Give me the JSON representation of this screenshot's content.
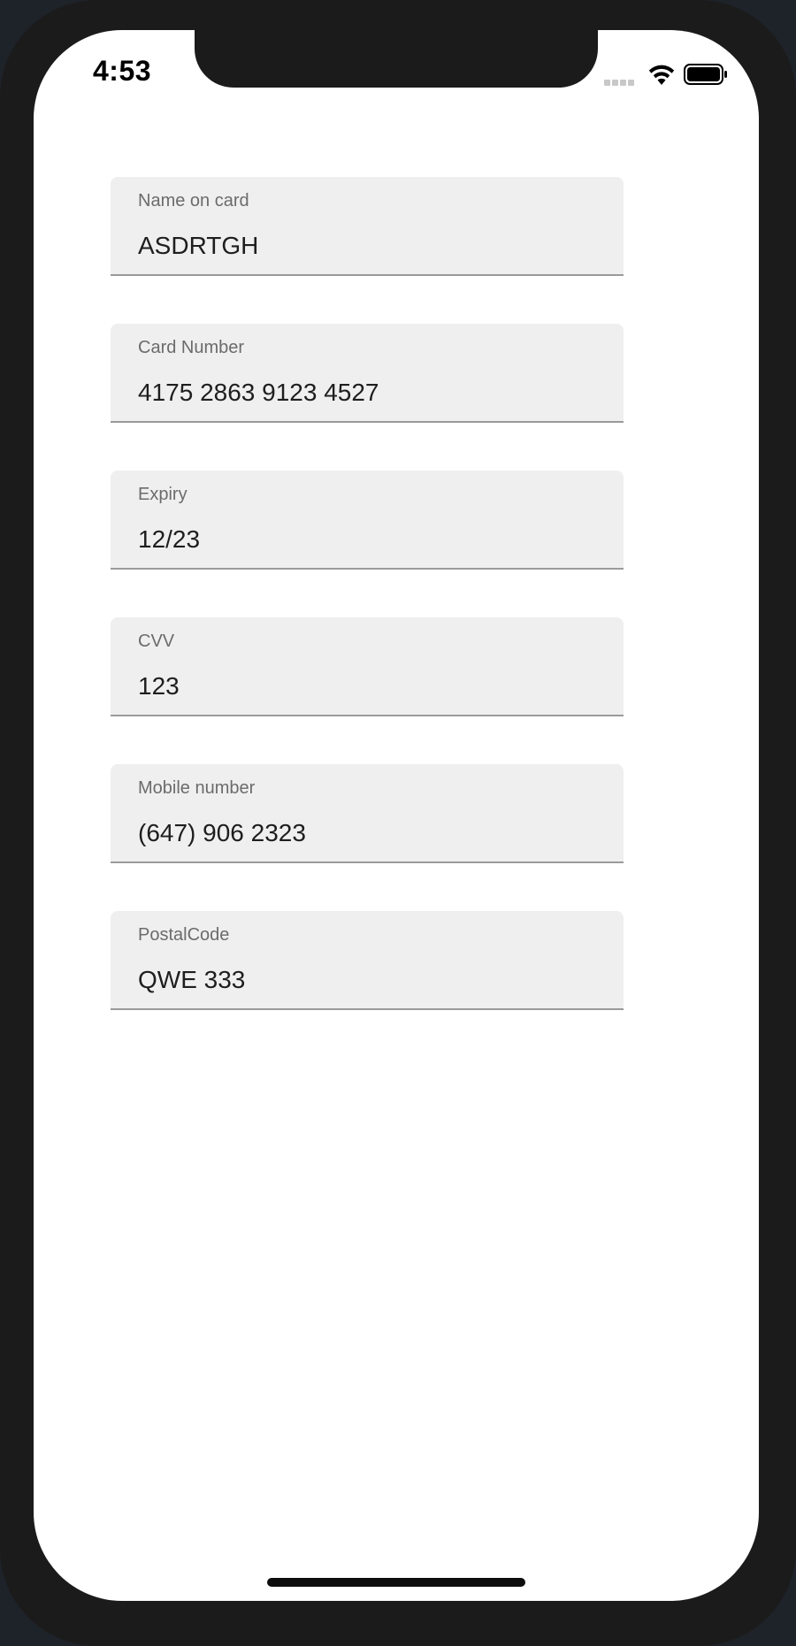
{
  "status_bar": {
    "time": "4:53",
    "signal_icon": "cellular-signal-icon",
    "wifi_icon": "wifi-icon",
    "battery_icon": "battery-icon"
  },
  "form": {
    "fields": [
      {
        "label": "Name on card",
        "value": "ASDRTGH"
      },
      {
        "label": "Card Number",
        "value": "4175 2863 9123 4527"
      },
      {
        "label": "Expiry",
        "value": "12/23"
      },
      {
        "label": "CVV",
        "value": "123"
      },
      {
        "label": "Mobile number",
        "value": "(647) 906 2323"
      },
      {
        "label": "PostalCode",
        "value": "QWE 333"
      }
    ]
  },
  "colors": {
    "field_background": "#efefef",
    "field_underline": "#9a9a9a",
    "label_text": "#6b6b6b",
    "value_text": "#1e1e1e",
    "device_frame": "#1b1b1c"
  }
}
